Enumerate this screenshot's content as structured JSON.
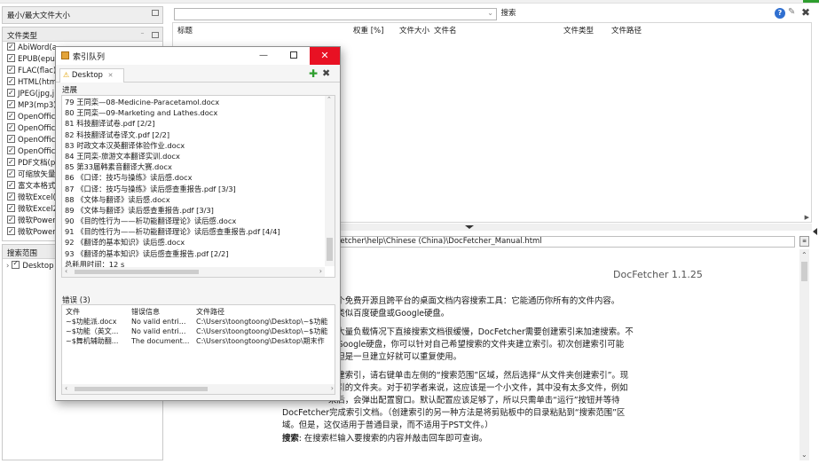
{
  "app": {
    "colors": {
      "close_red": "#e81123",
      "accent_green": "#2e9e2e",
      "link_blue": "#1d5fc4"
    }
  },
  "left_panel": {
    "size_header": "最小/最大文件大小",
    "types_header": "文件类型",
    "file_types": [
      "AbiWord(a",
      "EPUB(epul",
      "FLAC(flac)",
      "HTML(htm",
      "JPEG(jpg,j",
      "MP3(mp3)",
      "OpenOffic",
      "OpenOffic",
      "OpenOffic",
      "OpenOffic",
      "PDF文档(p",
      "可缩放矢量",
      "富文本格式",
      "微软Excel(",
      "微软Excel2",
      "微软Power",
      "微软Power"
    ],
    "scope_header": "搜索范围",
    "scope_item": "Desktop"
  },
  "search_bar": {
    "query": "",
    "search_button": "搜索",
    "help_icon": "help-icon",
    "pin_icon": "pin-icon",
    "close_icon": "close-all-icon"
  },
  "results": {
    "columns": [
      "标题",
      "权重 [%]",
      "文件大小",
      "文件名",
      "文件类型",
      "文件路径"
    ]
  },
  "preview": {
    "path": "Fetcher\\help\\Chinese (China)\\DocFetcher_Manual.html",
    "version": "DocFetcher 1.1.25",
    "lines": [
      "一个免费开源且跨平台的桌面文档内容搜索工具：它能通历你所有的文件内容。",
      "，类似百度硬盘或Google硬盘。",
      "于大量负载情况下直接搜索文档很缓慢，DocFetcher需要创建索引来加速搜索。不",
      "和Google硬盘，你可以针对自己希望搜索的文件夹建立索引。初次创建索引可能",
      "，但是一旦建立好就可以重复使用。",
      "创建索引，请右键单击左侧的“搜索范围”区域，然后选择“从文件夹创建索引”。现",
      "索引的文件夹。对于初学者来说，这应该是一个小文件，其中没有太多文件，例如",
      "来后，会弹出配置窗口。默认配置应该足够了，所以只需单击“运行”按钮并等待",
      "DocFetcher完成索引文档。（创建索引的另一种方法是将剪贴板中的目录粘贴到“搜索范围”区",
      "域。但是，这仅适用于普通目录，而不适用于PST文件。）"
    ],
    "search_label": "搜索",
    "search_text": ": 在搜索栏输入要搜索的内容并敲击回车即可查询。"
  },
  "index_queue": {
    "title": "索引队列",
    "tab_label": "Desktop",
    "progress_label": "进展",
    "progress_items": [
      "79 王同栾—08-Medicine-Paracetamol.docx",
      "80 王同栾—09-Marketing and Lathes.docx",
      "81 科技翻译试卷.pdf [2/2]",
      "82 科技翻译试卷译文.pdf [2/2]",
      "83 时政文本汉英翻译体验作业.docx",
      "84 王同栾-旅游文本翻译实训.docx",
      "85 第33届韩素音翻译大赛.docx",
      "86 《口译：技巧与操练》读后感.docx",
      "87 《口译：技巧与操练》读后感查重报告.pdf [3/3]",
      "88 《文体与翻译》读后感.docx",
      "89 《文体与翻译》读后感查重报告.pdf [3/3]",
      "90 《目的性行为——析功能翻译理论》读后感.docx",
      "91 《目的性行为——析功能翻译理论》读后感查重报告.pdf [4/4]",
      "92 《翻译的基本知识》读后感.docx",
      "93 《翻译的基本知识》读后感查重报告.pdf [2/2]",
      "总耗用时间：12 s"
    ],
    "errors_label": "错误 (3)",
    "error_columns": [
      "文件",
      "错误信息",
      "文件路径"
    ],
    "errors": [
      [
        "~$功能派.docx",
        "No valid entri...",
        "C:\\Users\\toongtoong\\Desktop\\~$功能"
      ],
      [
        "~$功能（英文...",
        "No valid entri...",
        "C:\\Users\\toongtoong\\Desktop\\~$功能"
      ],
      [
        "~$舞机辅助翻...",
        "The document...",
        "C:\\Users\\toongtoong\\Desktop\\期末作"
      ]
    ]
  }
}
